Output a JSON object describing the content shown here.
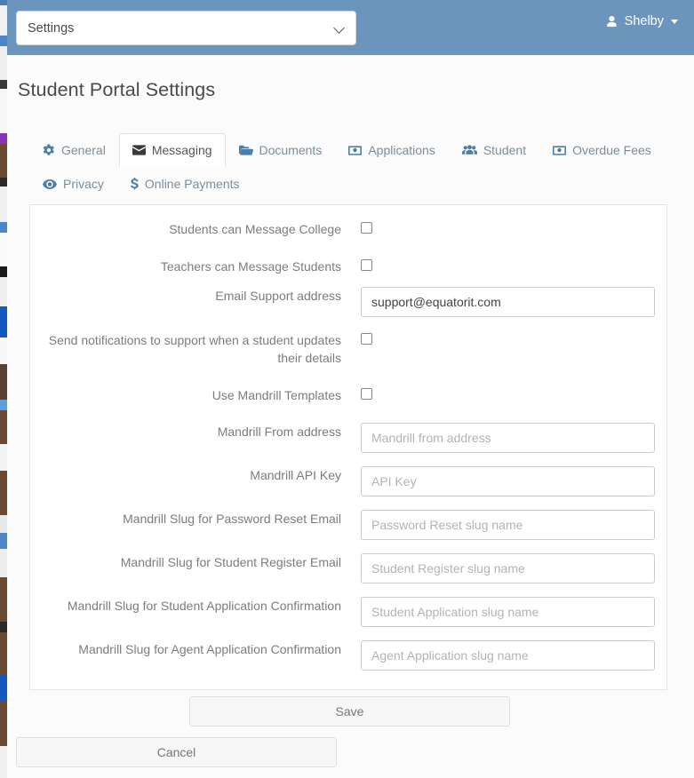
{
  "topbar": {
    "context_select": {
      "value": "Settings",
      "icon": "chevron-down-icon"
    },
    "user": {
      "name": "Shelby",
      "icon": "user-icon",
      "caret": "caret-down-icon"
    }
  },
  "page": {
    "title": "Student Portal Settings"
  },
  "tabs": [
    {
      "label": "General",
      "icon": "gear-icon",
      "active": false
    },
    {
      "label": "Messaging",
      "icon": "envelope-icon",
      "active": true
    },
    {
      "label": "Documents",
      "icon": "folder-icon",
      "active": false
    },
    {
      "label": "Applications",
      "icon": "money-icon",
      "active": false
    },
    {
      "label": "Student",
      "icon": "users-icon",
      "active": false
    },
    {
      "label": "Overdue Fees",
      "icon": "money-icon",
      "active": false
    },
    {
      "label": "Privacy",
      "icon": "eye-icon",
      "active": false
    },
    {
      "label": "Online Payments",
      "icon": "dollar-icon",
      "active": false
    }
  ],
  "form": {
    "fields": [
      {
        "label": "Students can Message College",
        "type": "checkbox",
        "name": "students-can-message-college",
        "checked": false
      },
      {
        "label": "Teachers can Message Students",
        "type": "checkbox",
        "name": "teachers-can-message-students",
        "checked": false
      },
      {
        "label": "Email Support address",
        "type": "text",
        "name": "email-support-address",
        "value": "support@equatorit.com",
        "placeholder": ""
      },
      {
        "label": "Send notifications to support when a student updates their details",
        "type": "checkbox",
        "name": "send-notifications-to-support",
        "checked": false
      },
      {
        "label": "Use Mandrill Templates",
        "type": "checkbox",
        "name": "use-mandrill-templates",
        "checked": false
      },
      {
        "label": "Mandrill From address",
        "type": "text",
        "name": "mandrill-from-address",
        "value": "",
        "placeholder": "Mandrill from address"
      },
      {
        "label": "Mandrill API Key",
        "type": "text",
        "name": "mandrill-api-key",
        "value": "",
        "placeholder": "API Key"
      },
      {
        "label": "Mandrill Slug for Password Reset Email",
        "type": "text",
        "name": "mandrill-slug-password-reset",
        "value": "",
        "placeholder": "Password Reset slug name"
      },
      {
        "label": "Mandrill Slug for Student Register Email",
        "type": "text",
        "name": "mandrill-slug-student-register",
        "value": "",
        "placeholder": "Student Register slug name"
      },
      {
        "label": "Mandrill Slug for Student Application Confirmation",
        "type": "text",
        "name": "mandrill-slug-student-application",
        "value": "",
        "placeholder": "Student Application slug name"
      },
      {
        "label": "Mandrill Slug for Agent Application Confirmation",
        "type": "text",
        "name": "mandrill-slug-agent-application",
        "value": "",
        "placeholder": "Agent Application slug name"
      }
    ]
  },
  "footer": {
    "save_label": "Save",
    "cancel_label": "Cancel"
  },
  "colors": {
    "header_blue": "#6b95bd",
    "tab_link": "#7a8e9c",
    "tab_icon": "#4a7fa8",
    "label_text": "#7c7c7c",
    "placeholder": "#b3b3b3",
    "page_bg": "#fbfbfb",
    "card_bg": "#ffffff"
  }
}
